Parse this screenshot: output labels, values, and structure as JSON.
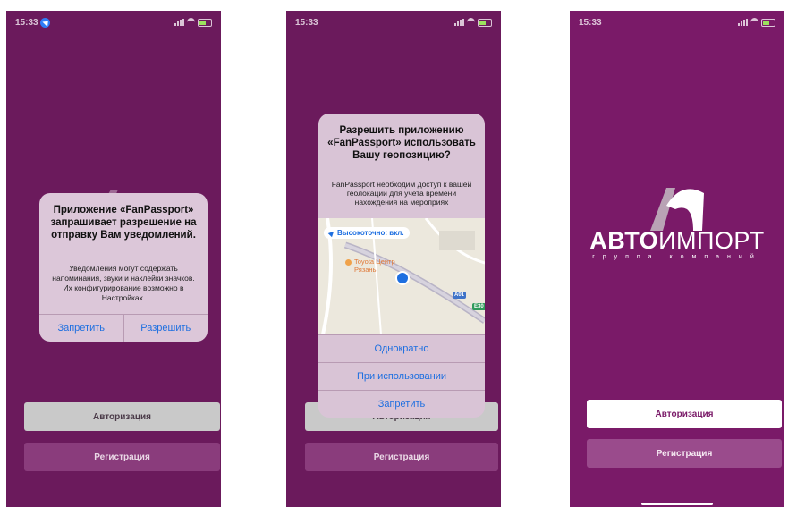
{
  "colors": {
    "bg": "#6b1a5c",
    "accent": "#1e6fe0",
    "auth_btn": "#c9c9c9",
    "reg_btn": "#8a3c7c"
  },
  "screens": [
    {
      "status": {
        "time": "15:33",
        "location_icon": "location-arrow-icon"
      },
      "alert": {
        "title": "Приложение «FanPassport» запрашивает разрешение на отправку Вам уведомлений.",
        "message": "Уведомления могут содержать напоминания, звуки и наклейки значков. Их конфигурирование возможно в Настройках.",
        "deny": "Запретить",
        "allow": "Разрешить"
      },
      "buttons": {
        "auth": "Авторизация",
        "register": "Регистрация"
      }
    },
    {
      "status": {
        "time": "15:33"
      },
      "alert": {
        "title": "Разрешить приложению «FanPassport» использовать Вашу геопозицию?",
        "message": "FanPassport необходим доступ к вашей геолокации для учета времени нахождения на мероприях",
        "map": {
          "precise": "Высокоточно: вкл.",
          "poi": "Toyota Центр Рязань",
          "road1": "А01",
          "road2": "Е30"
        },
        "once": "Однократно",
        "while_using": "При использовании",
        "deny": "Запретить"
      },
      "buttons": {
        "auth": "Авторизация",
        "register": "Регистрация"
      }
    },
    {
      "status": {
        "time": "15:33"
      },
      "brand": {
        "part1": "АВТО",
        "part2": "ИМПОРТ",
        "tagline": "группа компаний"
      },
      "buttons": {
        "auth": "Авторизация",
        "register": "Регистрация"
      }
    }
  ]
}
